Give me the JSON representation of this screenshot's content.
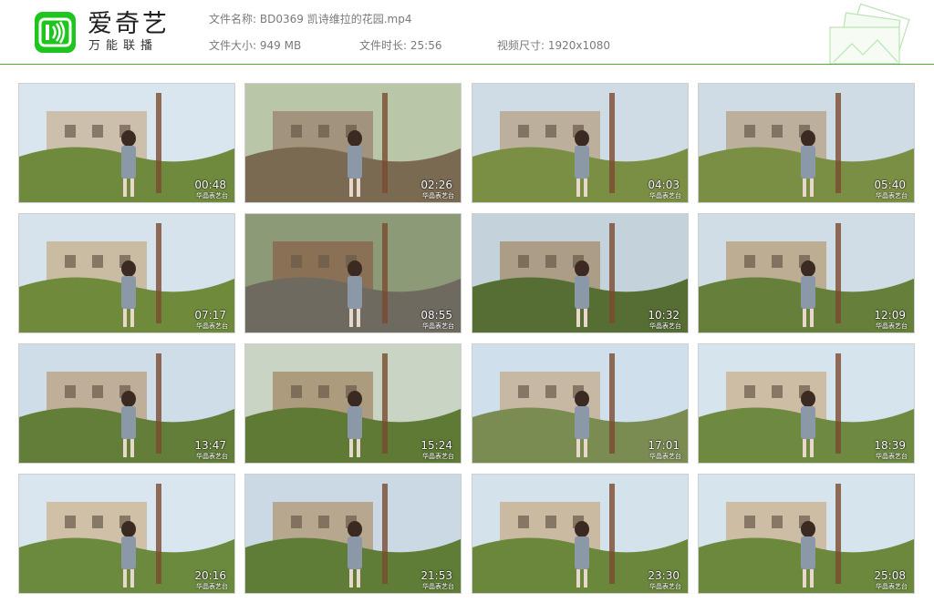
{
  "app": {
    "brand_name": "爱奇艺",
    "brand_slogan": "万能联播",
    "accent_color": "#1ec51e",
    "logo_icon": "iqiyi-logo-icon"
  },
  "file_info": {
    "name_label": "文件名称:",
    "name_value": "BD0369 凯诗维拉的花园.mp4",
    "size_label": "文件大小:",
    "size_value": "949 MB",
    "duration_label": "文件时长:",
    "duration_value": "25:56",
    "resolution_label": "视频尺寸:",
    "resolution_value": "1920x1080"
  },
  "watermark": "华晶表艺台",
  "thumbnails": [
    {
      "time": "00:48"
    },
    {
      "time": "02:26"
    },
    {
      "time": "04:03"
    },
    {
      "time": "05:40"
    },
    {
      "time": "07:17"
    },
    {
      "time": "08:55"
    },
    {
      "time": "10:32"
    },
    {
      "time": "12:09"
    },
    {
      "time": "13:47"
    },
    {
      "time": "15:24"
    },
    {
      "time": "17:01"
    },
    {
      "time": "18:39"
    },
    {
      "time": "20:16"
    },
    {
      "time": "21:53"
    },
    {
      "time": "23:30"
    },
    {
      "time": "25:08"
    }
  ]
}
